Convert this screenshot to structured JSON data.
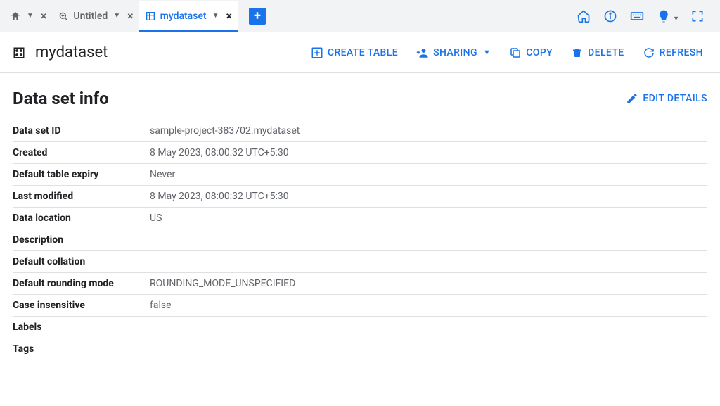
{
  "tabs": {
    "home": {
      "label": ""
    },
    "untitled": {
      "label": "Untitled"
    },
    "active": {
      "label": "mydataset"
    }
  },
  "header": {
    "title": "mydataset"
  },
  "actions": {
    "create_table": "CREATE TABLE",
    "sharing": "SHARING",
    "copy": "COPY",
    "delete": "DELETE",
    "refresh": "REFRESH"
  },
  "section": {
    "title": "Data set info",
    "edit_details": "EDIT DETAILS"
  },
  "info": {
    "rows": [
      {
        "label": "Data set ID",
        "value": "sample-project-383702.mydataset"
      },
      {
        "label": "Created",
        "value": "8 May 2023, 08:00:32 UTC+5:30"
      },
      {
        "label": "Default table expiry",
        "value": "Never"
      },
      {
        "label": "Last modified",
        "value": "8 May 2023, 08:00:32 UTC+5:30"
      },
      {
        "label": "Data location",
        "value": "US"
      },
      {
        "label": "Description",
        "value": ""
      },
      {
        "label": "Default collation",
        "value": ""
      },
      {
        "label": "Default rounding mode",
        "value": "ROUNDING_MODE_UNSPECIFIED"
      },
      {
        "label": "Case insensitive",
        "value": "false"
      },
      {
        "label": "Labels",
        "value": ""
      },
      {
        "label": "Tags",
        "value": ""
      }
    ]
  }
}
